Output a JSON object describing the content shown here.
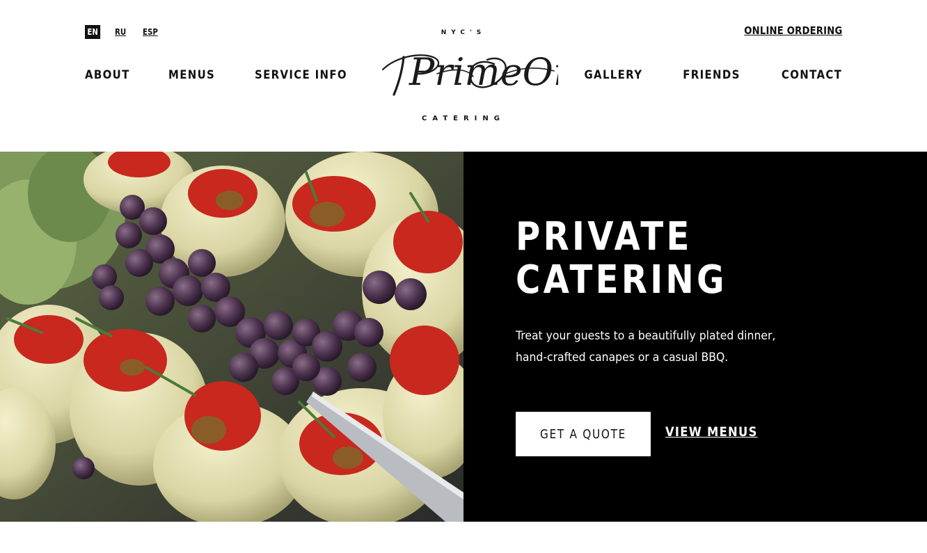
{
  "languages": [
    {
      "code": "EN",
      "active": true
    },
    {
      "code": "RU",
      "active": false
    },
    {
      "code": "ESP",
      "active": false
    }
  ],
  "header": {
    "online_ordering": "ONLINE ORDERING",
    "nav_left": [
      "ABOUT",
      "MENUS",
      "SERVICE INFO"
    ],
    "nav_right": [
      "GALLERY",
      "FRIENDS",
      "CONTACT"
    ]
  },
  "logo": {
    "top_text": "NYC'S",
    "script_text": "PrimeOne",
    "bottom_text": "CATERING"
  },
  "hero": {
    "title_line1": "PRIVATE",
    "title_line2": "CATERING",
    "description": "Treat your guests to a beautifully plated dinner, hand-crafted canapes or a casual BBQ.",
    "quote_button": "GET A QUOTE",
    "menus_link": "VIEW MENUS",
    "image_icon": "food-photo-artichokes-grapes"
  },
  "colors": {
    "panel_bg": "#000000",
    "text_dark": "#111111",
    "text_light": "#ffffff"
  }
}
